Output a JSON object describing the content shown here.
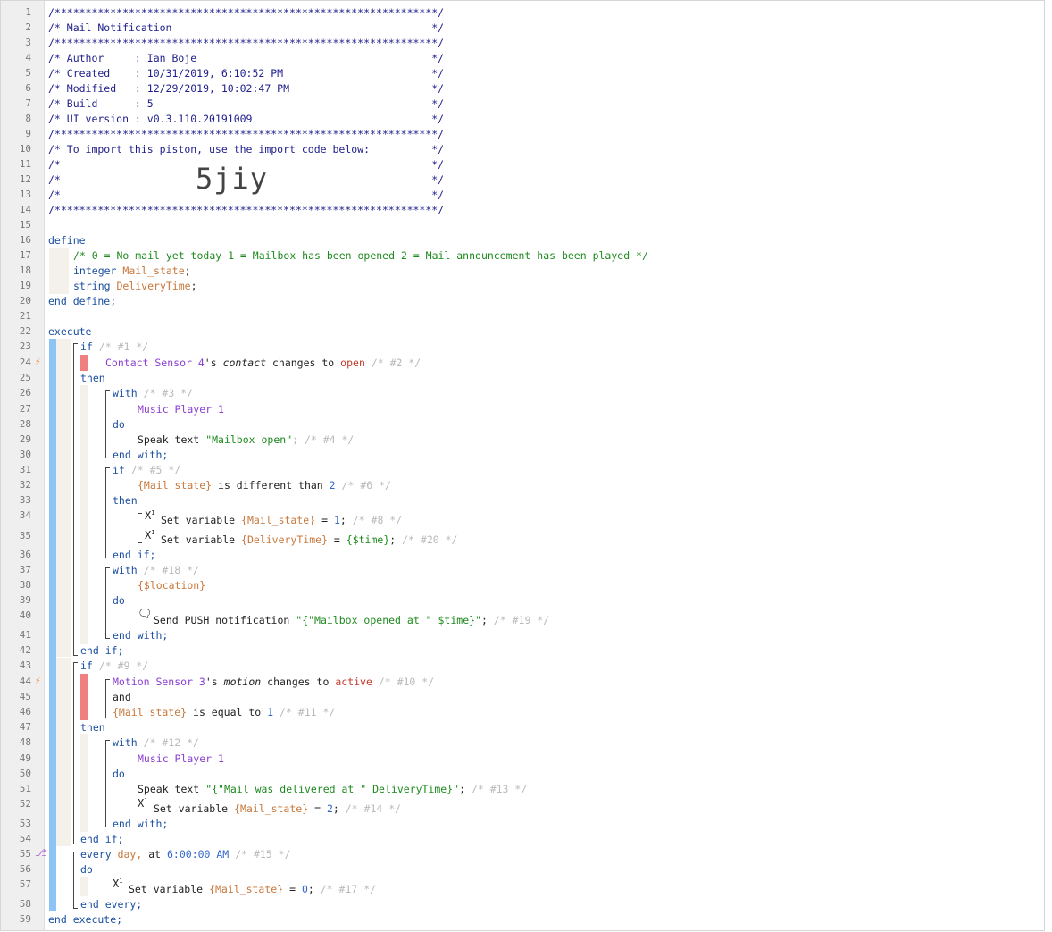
{
  "header_lines": [
    "/**************************************************************/",
    "/* Mail Notification                                          */",
    "/**************************************************************/",
    "/* Author     : Ian Boje                                      */",
    "/* Created    : 10/31/2019, 6:10:52 PM                        */",
    "/* Modified   : 12/29/2019, 10:02:47 PM                       */",
    "/* Build      : 5                                             */",
    "/* UI version : v0.3.110.20191009                             */",
    "/**************************************************************/",
    "/* To import this piston, use the import code below:          */",
    "/*                                                            */",
    "/*                                                            */",
    "/*                                                            */",
    "/**************************************************************/"
  ],
  "import_code": "5jiy",
  "code": {
    "define": "define",
    "define_comment": "/* 0 = No mail yet today 1 = Mailbox has been opened 2 = Mail announcement has been played */",
    "integer": "integer",
    "mail_state_decl": "Mail_state",
    "string": "string",
    "delivery_decl": "DeliveryTime",
    "semicolon": ";",
    "end_define": "end define;",
    "execute": "execute",
    "if": "if",
    "c1": "/* #1 */",
    "contact_device": "Contact Sensor 4",
    "poss": "'s",
    "contact_attr": "contact",
    "changes_to": "changes to",
    "open": "open",
    "c2": "/* #2 */",
    "then": "then",
    "with": "with",
    "c3": "/* #3 */",
    "music_player": "Music Player 1",
    "do": "do",
    "speak_text": "Speak text",
    "mailbox_open": "\"Mailbox open\"",
    "c4": "; /* #4 */",
    "end_with": "end with;",
    "c5": "/* #5 */",
    "mail_state_ref": "{Mail_state}",
    "is_different": "is different than",
    "two": "2",
    "c6": "/* #6 */",
    "set_variable": "Set variable",
    "eq": "=",
    "one": "1",
    "c8": "/* #8 */",
    "delivery_ref": "{DeliveryTime}",
    "time_expr": "{$time}",
    "c20": "/* #20 */",
    "end_if": "end if;",
    "c18": "/* #18 */",
    "location": "{$location}",
    "send_push": "Send PUSH notification",
    "push_msg": "\"{\"Mailbox opened at \" $time}\"",
    "c19": "/* #19 */",
    "c9": "/* #9 */",
    "motion_device": "Motion Sensor 3",
    "motion_attr": "motion",
    "active": "active",
    "c10": "/* #10 */",
    "and": "and",
    "is_equal": "is equal to",
    "c11": "/* #11 */",
    "c12": "/* #12 */",
    "delivered_msg": "\"{\"Mail was delivered at \" DeliveryTime}\"",
    "c13": "/* #13 */",
    "c14": "/* #14 */",
    "every": "every",
    "day": "day,",
    "at": "at",
    "six_am": "6:00:00 AM",
    "c15": "/* #15 */",
    "zero": "0",
    "c17": "/* #17 */",
    "end_every": "end every;",
    "end_execute": "end execute;"
  },
  "colors": {
    "gutter": "#efefef",
    "blue_bar": "#8cc4f5",
    "trigger_bar": "#f08080",
    "nest_bar": "#f3f1ea",
    "keyword": "#1a4fa0",
    "device": "#8a3fd0",
    "variable": "#c8783c",
    "string": "#1e8a1e",
    "comment": "#b9b9b9"
  },
  "icons": [
    "trigger-bolt-icon",
    "timer-icon",
    "set-variable-icon",
    "chat-bubble-icon"
  ]
}
